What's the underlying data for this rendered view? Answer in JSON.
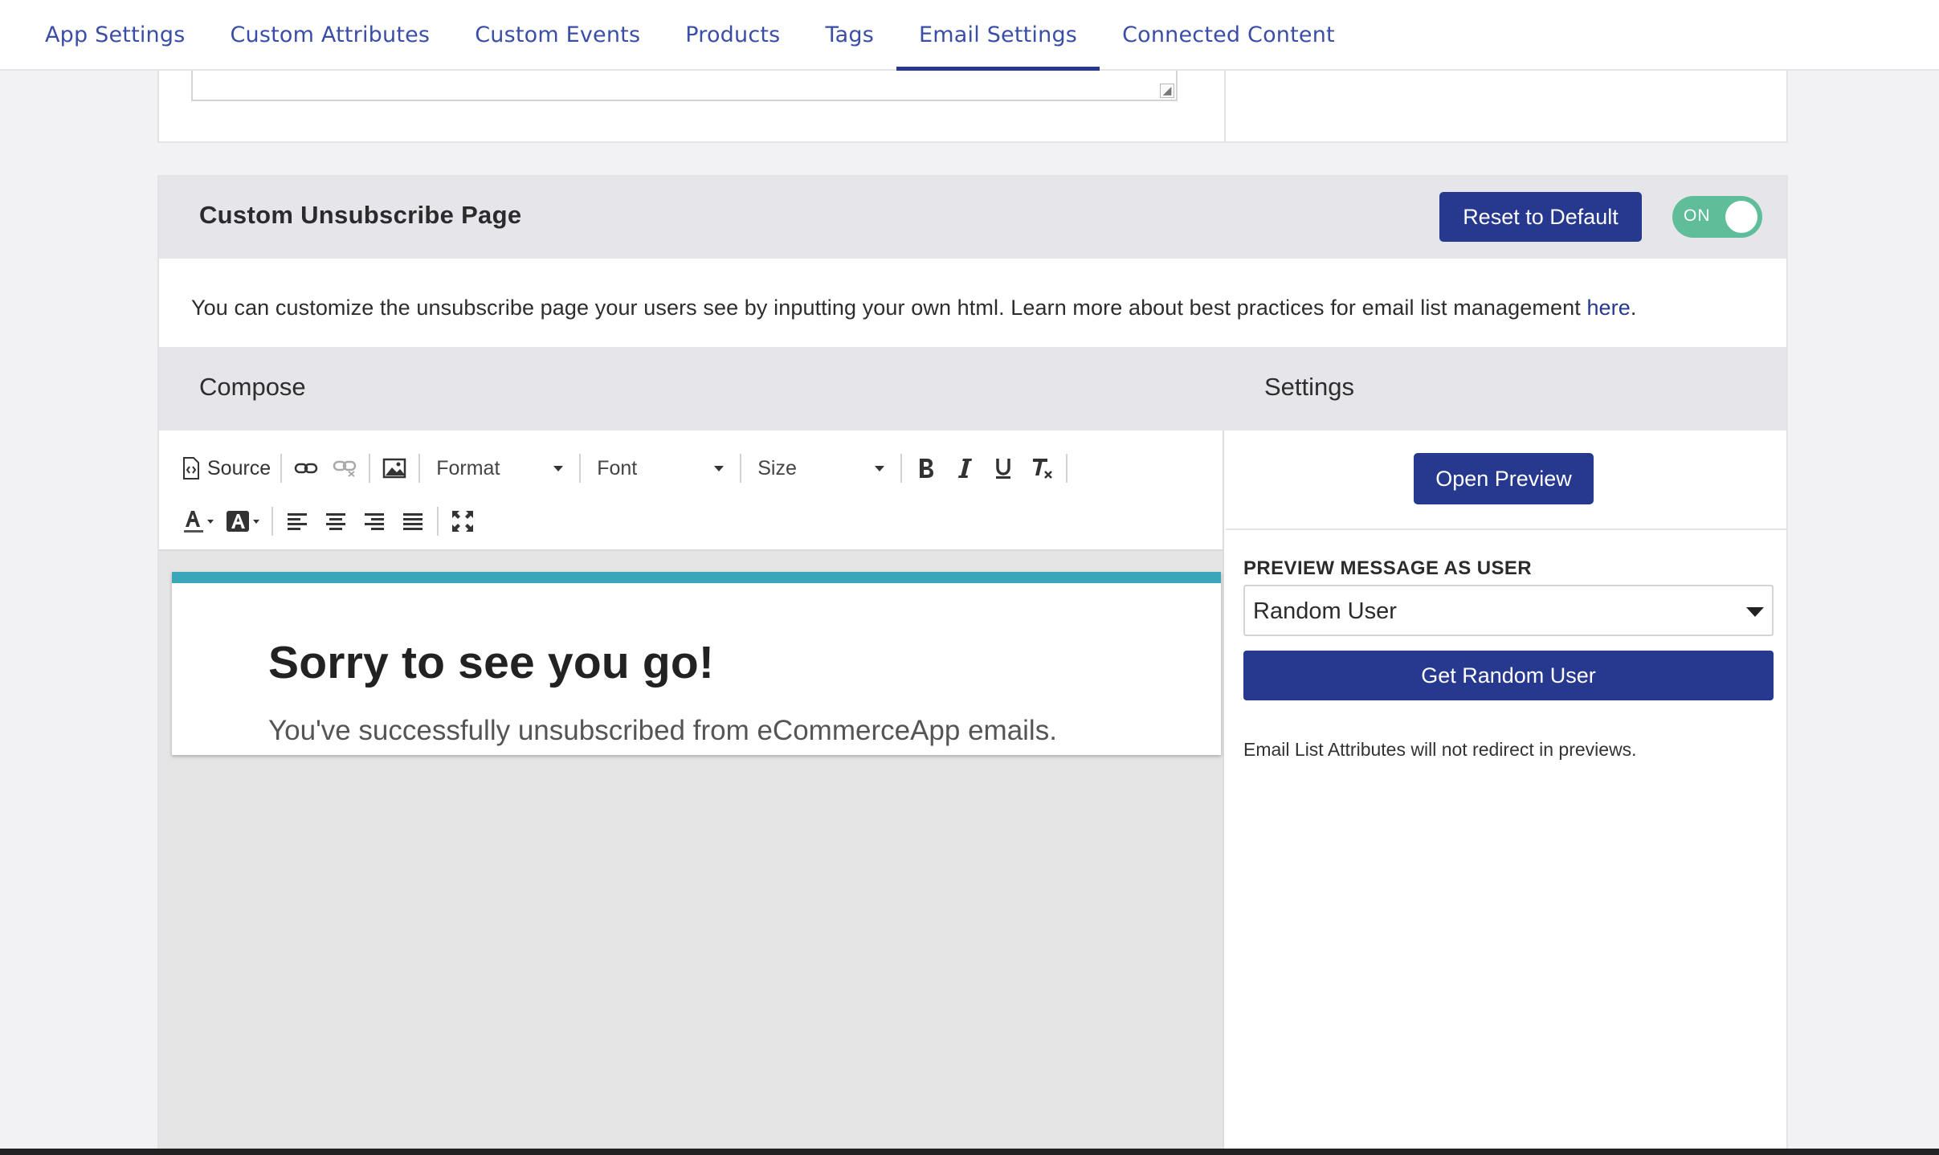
{
  "nav": {
    "tabs": [
      {
        "label": "App Settings"
      },
      {
        "label": "Custom Attributes"
      },
      {
        "label": "Custom Events"
      },
      {
        "label": "Products"
      },
      {
        "label": "Tags"
      },
      {
        "label": "Email Settings",
        "active": true
      },
      {
        "label": "Connected Content"
      }
    ]
  },
  "unsubscribe": {
    "title": "Custom Unsubscribe Page",
    "reset_label": "Reset to Default",
    "toggle_label": "ON",
    "description": "You can customize the unsubscribe page your users see by inputting your own html. Learn more about best practices for email list management ",
    "description_link": "here",
    "description_end": "."
  },
  "compose": {
    "title": "Compose",
    "toolbar": {
      "source_label": "Source",
      "format_label": "Format",
      "font_label": "Font",
      "size_label": "Size",
      "icons": [
        "source-icon",
        "link-icon",
        "unlink-icon",
        "image-icon",
        "bold-icon",
        "italic-icon",
        "underline-icon",
        "remove-format-icon",
        "text-color-icon",
        "background-color-icon",
        "align-left-icon",
        "align-center-icon",
        "align-right-icon",
        "justify-icon",
        "maximize-icon"
      ]
    },
    "preview": {
      "heading": "Sorry to see you go!",
      "body": "You've successfully unsubscribed from eCommerceApp emails."
    }
  },
  "settings": {
    "title": "Settings",
    "open_preview_label": "Open Preview",
    "preview_as_label": "PREVIEW MESSAGE AS USER",
    "selected_user": "Random User",
    "get_random_label": "Get Random User",
    "note": "Email List Attributes will not redirect in previews."
  },
  "colors": {
    "primary": "#27388f",
    "toggle_on": "#5fbd99",
    "accent_bar": "#3aa6b9",
    "link": "#3a4ea8"
  }
}
